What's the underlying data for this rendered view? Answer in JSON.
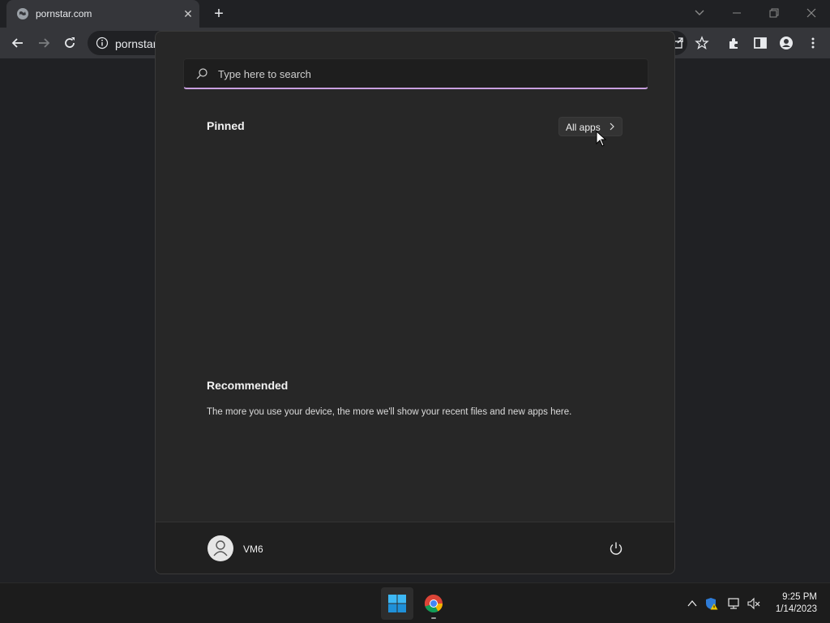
{
  "browser": {
    "tab": {
      "title": "pornstar.com",
      "favicon": "globe-icon",
      "close_icon": "close-icon"
    },
    "new_tab_icon": "plus-icon",
    "omnibox": {
      "url": "pornstar",
      "info_icon": "info-icon"
    },
    "toolbar_icons": [
      "back-arrow-icon",
      "forward-arrow-icon",
      "reload-icon",
      "share-icon",
      "star-icon",
      "extensions-icon",
      "side-panel-icon",
      "profile-icon",
      "more-vert-icon"
    ],
    "window_controls": [
      "chevron-down-icon",
      "minimize-icon",
      "restore-icon",
      "close-icon"
    ]
  },
  "start_menu": {
    "search": {
      "placeholder": "Type here to search",
      "value": ""
    },
    "pinned": {
      "heading": "Pinned",
      "all_apps_label": "All apps"
    },
    "recommended": {
      "heading": "Recommended",
      "empty_text": "The more you use your device, the more we'll show your recent files and new apps here."
    },
    "footer": {
      "user_name": "VM6",
      "power_icon": "power-icon"
    },
    "accent_color": "#c99fe0"
  },
  "taskbar": {
    "apps": [
      "windows-start-icon",
      "chrome-icon"
    ],
    "tray_icons": [
      "chevron-up-icon",
      "defender-warning-icon",
      "network-icon",
      "volume-muted-icon"
    ],
    "clock": {
      "time": "9:25 PM",
      "date": "1/14/2023"
    }
  }
}
